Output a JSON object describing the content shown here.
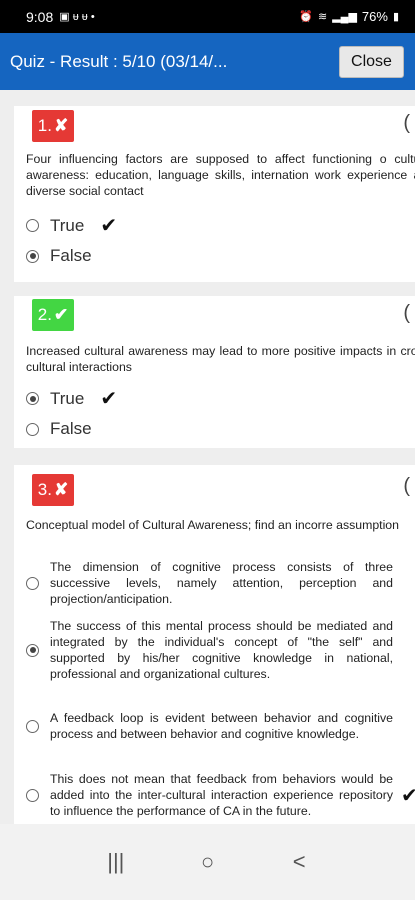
{
  "status_bar": {
    "time": "9:08",
    "battery": "76%"
  },
  "app_bar": {
    "title": "Quiz - Result : 5/10 (03/14/...",
    "close_label": "Close"
  },
  "questions": [
    {
      "number": "1.",
      "result": "wrong",
      "mark": "✘",
      "text": "Four influencing factors are supposed to affect functioning o cultural awareness: education, language skills, internation work experience and diverse social contact",
      "options": [
        {
          "label": "True",
          "selected": false,
          "correct": true
        },
        {
          "label": "False",
          "selected": true,
          "correct": false
        }
      ]
    },
    {
      "number": "2.",
      "result": "right",
      "mark": "✔",
      "text": "Increased cultural awareness may lead to more positive impacts in cross-cultural interactions",
      "options": [
        {
          "label": "True",
          "selected": true,
          "correct": true
        },
        {
          "label": "False",
          "selected": false,
          "correct": false
        }
      ]
    },
    {
      "number": "3.",
      "result": "wrong",
      "mark": "✘",
      "text": "Conceptual model of Cultural Awareness; find an incorre assumption",
      "options": [
        {
          "label": "The dimension of cognitive process consists of three successive levels, namely attention, perception and projection/anticipation.",
          "selected": false,
          "correct": false
        },
        {
          "label": "The success of this mental process should be mediated and integrated by the individual's concept of \"the self\" and supported by his/her cognitive knowledge in national, professional and organizational cultures.",
          "selected": true,
          "correct": false
        },
        {
          "label": "A feedback loop is evident between behavior and cognitive process and between behavior and cognitive knowledge.",
          "selected": false,
          "correct": false
        },
        {
          "label": "This does not mean that feedback from behaviors would be added into the inter-cultural interaction experience repository to influence the performance of CA in the future.",
          "selected": false,
          "correct": true
        }
      ]
    }
  ],
  "corner_symbol": "(",
  "check_symbol": "✔",
  "nav": {
    "recents": "|||",
    "home": "○",
    "back": "<"
  },
  "colors": {
    "app_bar": "#1565c0",
    "wrong": "#e53935",
    "right": "#43d643"
  }
}
